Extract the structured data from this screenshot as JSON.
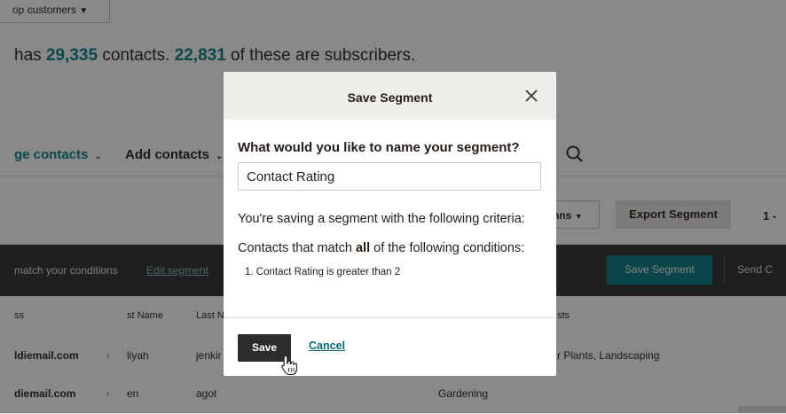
{
  "audience": {
    "select_label": "op customers"
  },
  "summary": {
    "prefix": "has ",
    "contacts_count": "29,335",
    "middle": " contacts. ",
    "subscribers_count": "22,831",
    "suffix": " of these are subscribers."
  },
  "nav": {
    "manage_contacts": "ge contacts",
    "add_contacts": "Add contacts"
  },
  "toolbar": {
    "columns_label": "nns",
    "export_label": "Export Segment",
    "pager": "1 -"
  },
  "segment_bar": {
    "match_text": "match your conditions",
    "edit_link": "Edit segment",
    "save_segment": "Save Segment",
    "send": "Send C"
  },
  "table": {
    "headers": {
      "email": "ss",
      "first_name": "st Name",
      "last_name": "Last N",
      "interests": "sts"
    },
    "rows": [
      {
        "email": "ldiemail.com",
        "first": "liyah",
        "last": "jenkir",
        "interests": "r Plants, Landscaping"
      },
      {
        "email": "diemail.com",
        "first": "en",
        "last": "agot",
        "interests": "Gardening"
      }
    ]
  },
  "modal": {
    "title": "Save Segment",
    "question": "What would you like to name your segment?",
    "name_value": "Contact Rating",
    "criteria_intro": "You're saving a segment with the following criteria:",
    "conditions_prefix": "Contacts that match ",
    "conditions_bold": "all",
    "conditions_suffix": " of the following conditions:",
    "condition_1": "1. Contact Rating is greater than 2",
    "save_label": "Save",
    "cancel_label": "Cancel"
  },
  "colors": {
    "accent": "#007c89",
    "primary_button": "#2c2c2c",
    "segment_button": "#00787f",
    "dark_bar": "#2b2b2b"
  }
}
